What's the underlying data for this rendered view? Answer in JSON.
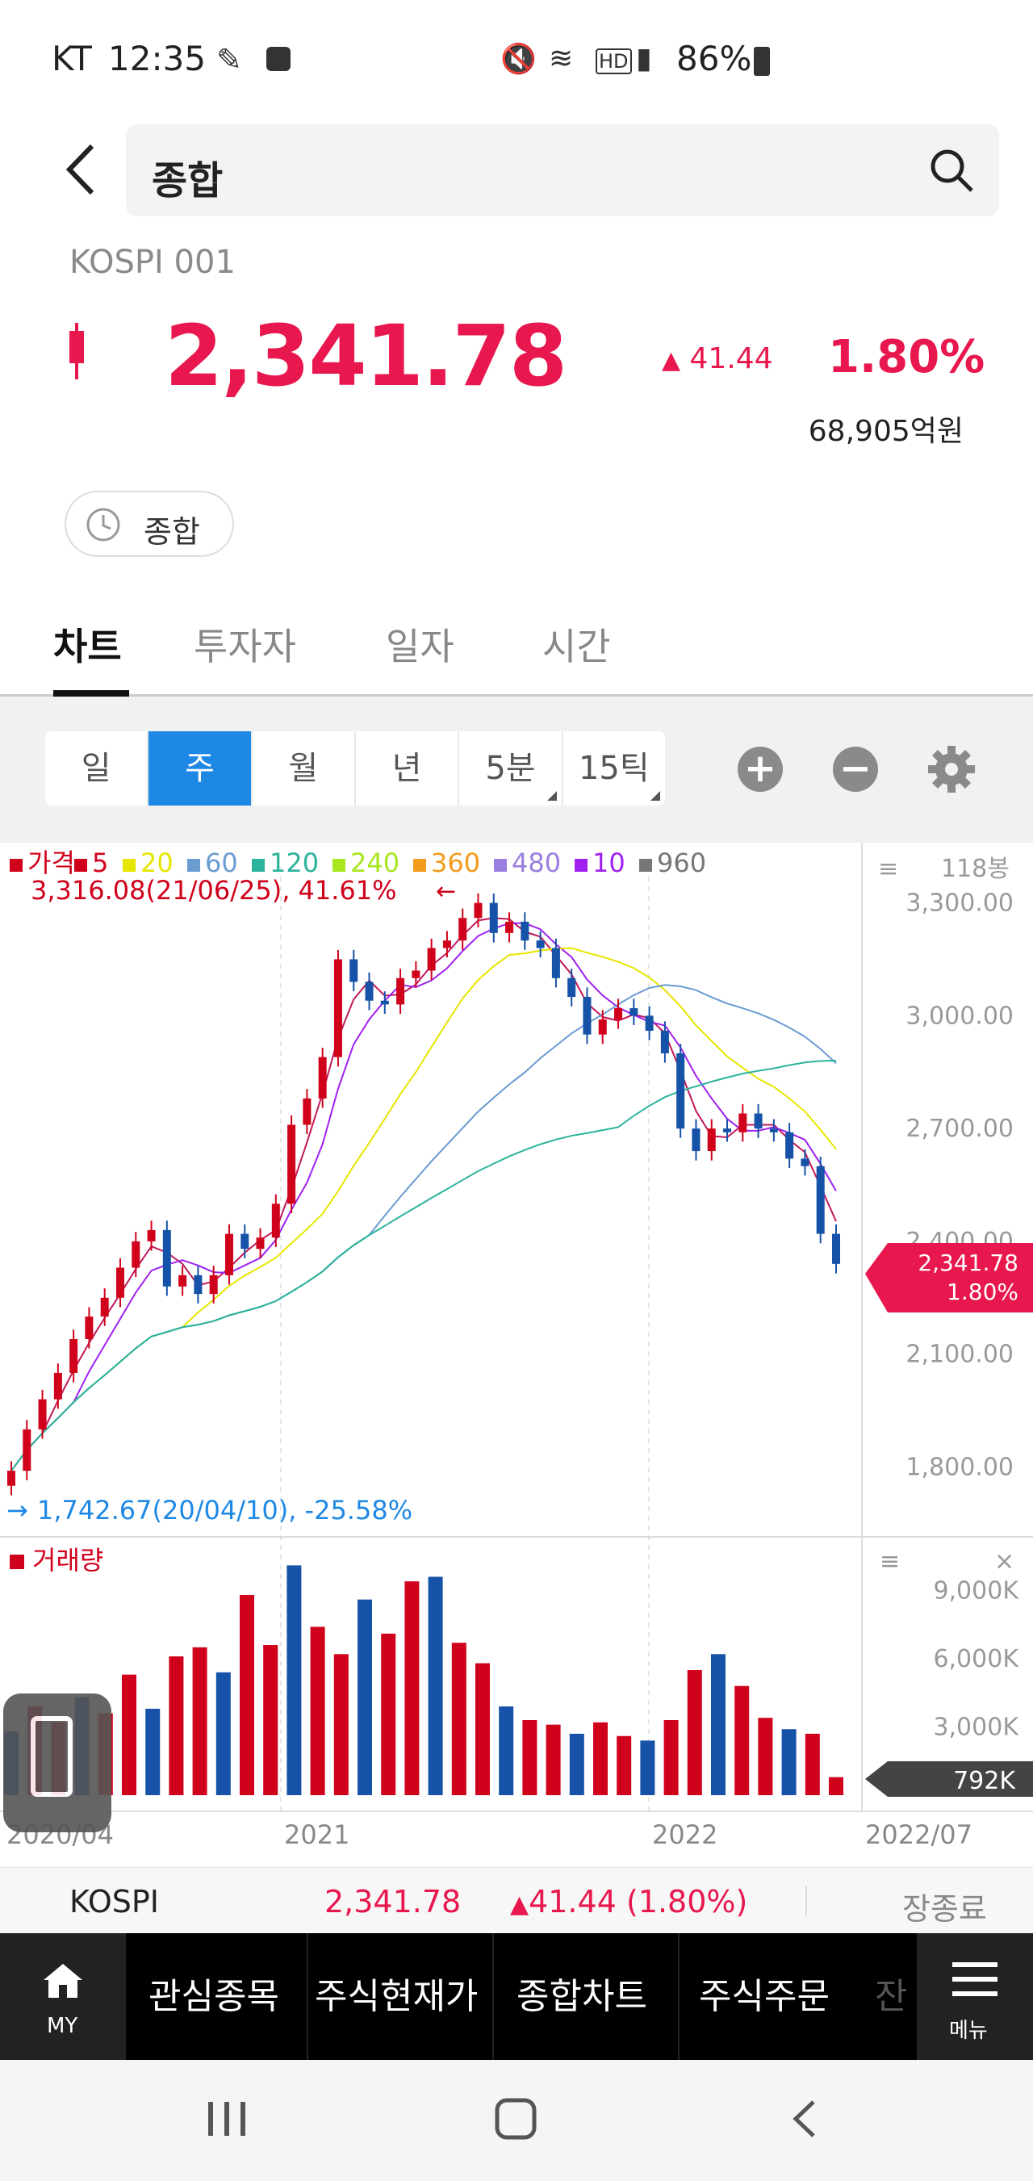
{
  "status_bar": {
    "carrier": "KT",
    "time": "12:35",
    "battery": "86%"
  },
  "header": {
    "search_query": "종합"
  },
  "stock": {
    "id": "KOSPI 001",
    "price": "2,341.78",
    "change": "41.44",
    "change_pct": "1.80%",
    "trade_value": "68,905억원",
    "market_filter": "종합"
  },
  "tabs": [
    "차트",
    "투자자",
    "일자",
    "시간"
  ],
  "period_buttons": [
    "일",
    "주",
    "월",
    "년",
    "5분",
    "15틱"
  ],
  "chart": {
    "legend": {
      "price": "가격",
      "ma": [
        "5",
        "20",
        "60",
        "120",
        "240",
        "360",
        "480",
        "10",
        "960"
      ]
    },
    "legend_colors": [
      "#d0021b",
      "#d0021b",
      "#e6e600",
      "#6a9bd1",
      "#2bb39b",
      "#a8e61e",
      "#f29b1d",
      "#9b7fe0",
      "#a020f0",
      "#777777"
    ],
    "high_annotation": "3,316.08(21/06/25), 41.61%",
    "low_annotation": "1,742.67(20/04/10), -25.58%",
    "bar_count": "118봉",
    "price_ticks": [
      "3,300.00",
      "3,000.00",
      "2,700.00",
      "2,400.00",
      "2,100.00",
      "1,800.00"
    ],
    "current_tag_price": "2,341.78",
    "current_tag_pct": "1.80%",
    "volume_label": "거래량",
    "volume_ticks": [
      "9,000K",
      "6,000K",
      "3,000K"
    ],
    "volume_tag": "792K",
    "x_labels": [
      "2020/04",
      "2021",
      "2022",
      "2022/07"
    ]
  },
  "chart_data": {
    "type": "candlestick",
    "x_labels": [
      "2020/04",
      "2021",
      "2022",
      "2022/07"
    ],
    "ylim": [
      1700,
      3400
    ],
    "weekly_close_approx": [
      1790,
      1900,
      1980,
      2050,
      2140,
      2200,
      2250,
      2330,
      2400,
      2430,
      2280,
      2310,
      2260,
      2310,
      2420,
      2380,
      2410,
      2500,
      2710,
      2780,
      2890,
      3150,
      3090,
      3040,
      3030,
      3100,
      3120,
      3180,
      3200,
      3260,
      3300,
      3220,
      3250,
      3200,
      3180,
      3100,
      3050,
      2950,
      2990,
      3020,
      3000,
      2960,
      2900,
      2700,
      2640,
      2700,
      2690,
      2740,
      2700,
      2690,
      2620,
      2600,
      2420,
      2340
    ],
    "volume_k_approx": [
      2800,
      3900,
      3200,
      4300,
      3600,
      5300,
      3800,
      6100,
      6500,
      5400,
      8800,
      6600,
      10100,
      7400,
      6200,
      8600,
      7100,
      9400,
      9600,
      6700,
      5800,
      3900,
      3300,
      3100,
      2700,
      3200,
      2600,
      2400,
      3300,
      5500,
      6200,
      4800,
      3400,
      2900,
      2700,
      792
    ]
  },
  "quote_bar": {
    "name": "KOSPI",
    "price": "2,341.78",
    "change": "41.44 (1.80%)",
    "status": "장종료"
  },
  "bottom_nav": {
    "home": "MY",
    "items": [
      "관심종목",
      "주식현재가",
      "종합차트",
      "주식주문",
      "잔"
    ],
    "menu": "메뉴"
  }
}
